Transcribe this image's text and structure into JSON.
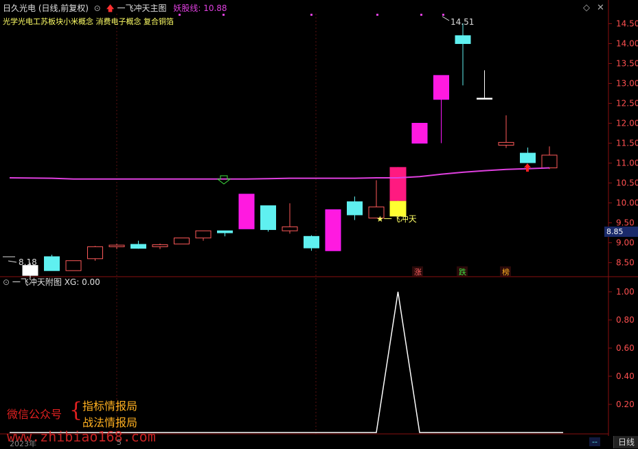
{
  "header": {
    "title": "日久光电 (日线,前复权)",
    "indicator_name": "一飞冲天主图",
    "yaoguxian_label": "妖股线: 10.88"
  },
  "concept_tags": "光学光电工苏板块小米概念 消费电子概念 复合铜箔",
  "sub_header": "一飞冲天附图 XG: 0.00",
  "signal_label": "★一飞冲天",
  "markers": {
    "high_label": "14.51",
    "low_label": "8.18"
  },
  "price_axis": [
    "14.50",
    "14.00",
    "13.50",
    "13.00",
    "12.50",
    "12.00",
    "11.50",
    "11.00",
    "10.50",
    "10.00",
    "9.50",
    "9.00",
    "8.50"
  ],
  "current_price": "8.85",
  "sub_axis": [
    "1.00",
    "0.80",
    "0.60",
    "0.40",
    "0.20"
  ],
  "legend_chars": {
    "zhang": "涨",
    "die": "跌",
    "bang": "榜"
  },
  "bottom": {
    "date_label": "2023年",
    "month_label": "5"
  },
  "status_bar": {
    "period": "日线",
    "dash": "--"
  },
  "watermark": {
    "wechat": "微信公众号",
    "line1": "指标情报局",
    "line2": "战法情报局",
    "url": "www.zhibiao168.com"
  },
  "colors": {
    "up": "#ff5a5a",
    "down": "#5ff0f0",
    "signal": "#ff1aff",
    "yaogu": "#e040e0",
    "bg": "#000000"
  },
  "chart_data": {
    "type": "candlestick",
    "ylim": [
      8.2,
      14.75
    ],
    "candles": [
      {
        "o": 8.43,
        "h": 8.5,
        "l": 8.1,
        "c": 8.18,
        "color": "flat"
      },
      {
        "o": 8.65,
        "h": 8.7,
        "l": 8.3,
        "c": 8.3,
        "color": "down"
      },
      {
        "o": 8.3,
        "h": 8.55,
        "l": 8.3,
        "c": 8.55,
        "color": "up"
      },
      {
        "o": 8.6,
        "h": 8.92,
        "l": 8.55,
        "c": 8.9,
        "color": "up"
      },
      {
        "o": 8.9,
        "h": 8.98,
        "l": 8.84,
        "c": 8.94,
        "color": "up"
      },
      {
        "o": 8.96,
        "h": 9.05,
        "l": 8.85,
        "c": 8.86,
        "color": "down"
      },
      {
        "o": 8.9,
        "h": 8.98,
        "l": 8.84,
        "c": 8.95,
        "color": "up"
      },
      {
        "o": 8.97,
        "h": 9.12,
        "l": 8.97,
        "c": 9.12,
        "color": "up"
      },
      {
        "o": 9.12,
        "h": 9.3,
        "l": 9.05,
        "c": 9.3,
        "color": "up"
      },
      {
        "o": 9.3,
        "h": 9.3,
        "l": 9.16,
        "c": 9.25,
        "color": "down"
      },
      {
        "o": 9.35,
        "h": 10.22,
        "l": 9.35,
        "c": 10.22,
        "color": "signal"
      },
      {
        "o": 9.93,
        "h": 9.93,
        "l": 9.28,
        "c": 9.33,
        "color": "down"
      },
      {
        "o": 9.3,
        "h": 9.99,
        "l": 9.23,
        "c": 9.4,
        "color": "up"
      },
      {
        "o": 9.16,
        "h": 9.19,
        "l": 8.8,
        "c": 8.87,
        "color": "down"
      },
      {
        "o": 8.8,
        "h": 9.83,
        "l": 8.8,
        "c": 9.83,
        "color": "signal"
      },
      {
        "o": 10.03,
        "h": 10.16,
        "l": 9.57,
        "c": 9.7,
        "color": "down"
      },
      {
        "o": 9.62,
        "h": 10.57,
        "l": 9.62,
        "c": 9.9,
        "color": "up"
      },
      {
        "o": 9.66,
        "h": 10.9,
        "l": 9.66,
        "c": 10.9,
        "color": "signal-yellow"
      },
      {
        "o": 11.5,
        "h": 12.0,
        "l": 11.5,
        "c": 12.0,
        "color": "signal"
      },
      {
        "o": 12.6,
        "h": 13.2,
        "l": 11.5,
        "c": 13.2,
        "color": "signal"
      },
      {
        "o": 14.2,
        "h": 14.51,
        "l": 12.95,
        "c": 14.0,
        "color": "down"
      },
      {
        "o": 12.63,
        "h": 13.33,
        "l": 12.63,
        "c": 12.63,
        "color": "flat"
      },
      {
        "o": 11.45,
        "h": 12.2,
        "l": 11.38,
        "c": 11.52,
        "color": "up"
      },
      {
        "o": 11.25,
        "h": 11.39,
        "l": 11.0,
        "c": 11.01,
        "color": "down"
      },
      {
        "o": 10.88,
        "h": 11.42,
        "l": 10.85,
        "c": 11.2,
        "color": "up"
      }
    ],
    "yaogu_line": [
      10.63,
      10.62,
      10.6,
      10.6,
      10.6,
      10.6,
      10.6,
      10.6,
      10.6,
      10.6,
      10.6,
      10.61,
      10.62,
      10.62,
      10.62,
      10.62,
      10.63,
      10.63,
      10.66,
      10.72,
      10.77,
      10.81,
      10.84,
      10.86,
      10.88
    ],
    "sub_series": [
      0,
      0,
      0,
      0,
      0,
      0,
      0,
      0,
      0,
      0,
      0,
      0,
      0,
      0,
      0,
      0,
      0,
      1,
      0,
      0,
      0,
      0,
      0,
      0,
      0
    ],
    "sub_ylim": [
      0,
      1.0
    ]
  }
}
